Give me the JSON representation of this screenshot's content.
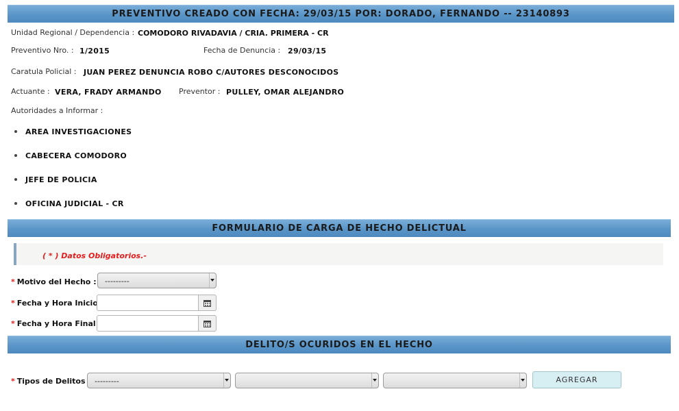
{
  "header": {
    "title": "PREVENTIVO CREADO CON FECHA: 29/03/15 POR: DORADO, FERNANDO -- 23140893"
  },
  "info": {
    "unidad_label": "Unidad Regional / Dependencia :",
    "unidad_value": "COMODORO RIVADAVIA / CRIA. PRIMERA - CR",
    "preventivo_label": "Preventivo Nro. :",
    "preventivo_value": "1/2015",
    "fecha_denuncia_label": "Fecha de Denuncia :",
    "fecha_denuncia_value": "29/03/15",
    "caratula_label": "Caratula Policial :",
    "caratula_value": "JUAN PEREZ DENUNCIA ROBO C/AUTORES DESCONOCIDOS",
    "actuante_label": "Actuante :",
    "actuante_value": "VERA, FRADY ARMANDO",
    "preventor_label": "Preventor :",
    "preventor_value": "PULLEY, OMAR ALEJANDRO",
    "autoridades_label": "Autoridades a Informar :",
    "autoridades": [
      "AREA INVESTIGACIONES",
      "CABECERA COMODORO",
      "JEFE DE POLICIA",
      "OFICINA JUDICIAL - CR"
    ]
  },
  "form": {
    "section_title": "FORMULARIO DE CARGA DE HECHO DELICTUAL",
    "notice": "( * ) Datos Obligatorios.-",
    "required_mark": "*",
    "motivo_label": "Motivo del Hecho :",
    "motivo_value": "---------",
    "fecha_inicio_label": "Fecha y Hora Inicio:",
    "fecha_inicio_value": "",
    "fecha_final_label": "Fecha y Hora Final :",
    "fecha_final_value": ""
  },
  "delitos": {
    "section_title": "DELITO/S OCURIDOS EN EL HECHO",
    "tipos_label": "Tipos de Delitos :",
    "select1_value": "---------",
    "select2_value": "",
    "select3_value": "",
    "add_button": "AGREGAR"
  },
  "icons": {
    "calendar": "calendar-icon",
    "bullet": "bullet-icon",
    "dropdown": "chevron-down-icon"
  },
  "colors": {
    "header_bar": "#5a95c8",
    "required": "#e01f1f",
    "button_bg": "#d7eef3"
  }
}
